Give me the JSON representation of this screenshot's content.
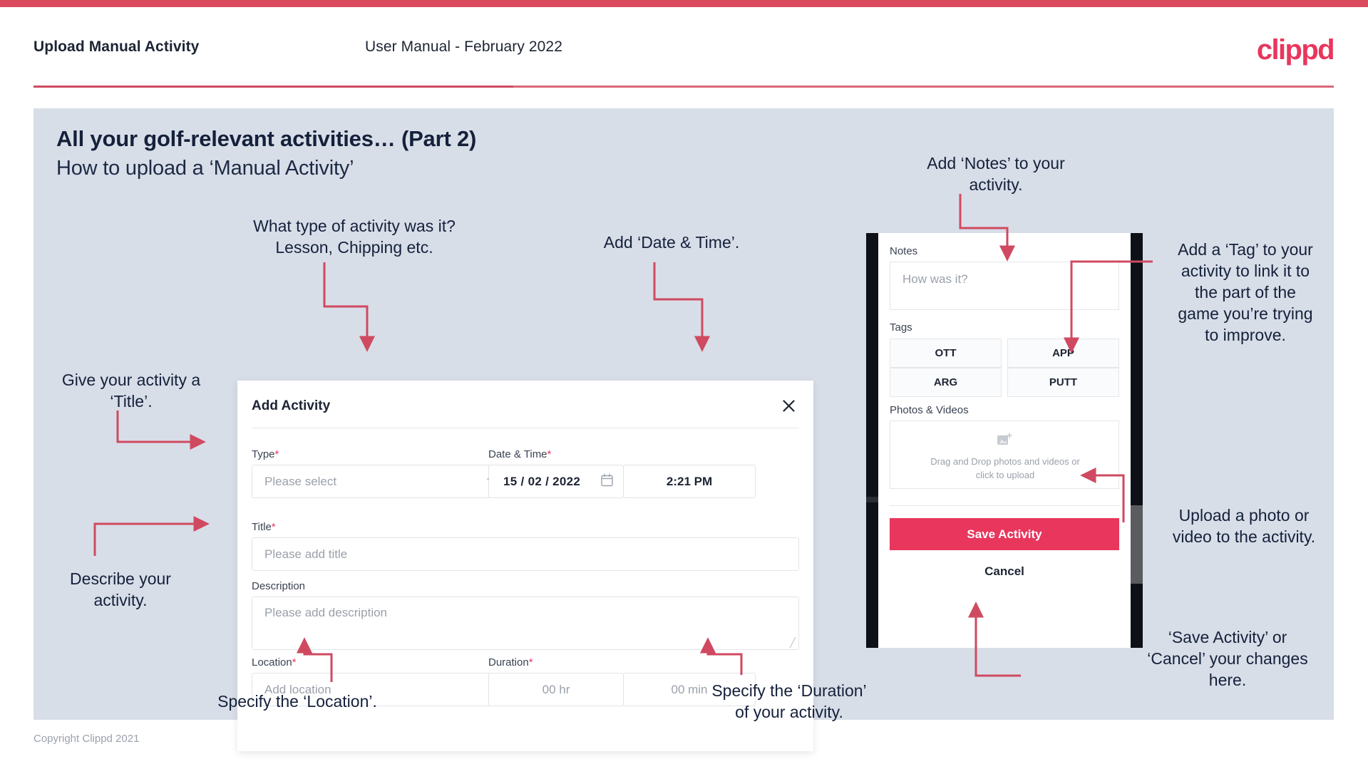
{
  "header": {
    "title": "Upload Manual Activity",
    "subtitle": "User Manual - February 2022",
    "logo": "clippd"
  },
  "slide": {
    "title": "All your golf-relevant activities… (Part 2)",
    "subtitle": "How to upload a ‘Manual Activity’"
  },
  "footer": {
    "copyright": "Copyright Clippd 2021"
  },
  "dialog": {
    "title": "Add Activity",
    "close_icon": "close-icon",
    "fields": {
      "type": {
        "label": "Type",
        "required": "*",
        "placeholder": "Please select",
        "chevron": "chevron-down-icon"
      },
      "datetime": {
        "label": "Date & Time",
        "required": "*",
        "date": "15 /  02  / 2022",
        "time": "2:21 PM",
        "calendar_icon": "calendar-icon"
      },
      "title": {
        "label": "Title",
        "required": "*",
        "placeholder": "Please add title"
      },
      "description": {
        "label": "Description",
        "required": "",
        "placeholder": "Please add description"
      },
      "location": {
        "label": "Location",
        "required": "*",
        "placeholder": "Add location"
      },
      "duration": {
        "label": "Duration",
        "required": "*",
        "hours": "00 hr",
        "minutes": "00 min"
      }
    }
  },
  "phone": {
    "notes": {
      "label": "Notes",
      "placeholder": "How was it?"
    },
    "tags": {
      "label": "Tags",
      "items": [
        "OTT",
        "APP",
        "ARG",
        "PUTT"
      ]
    },
    "photos": {
      "label": "Photos & Videos",
      "icon": "add-image-icon",
      "dropzone_line1": "Drag and Drop photos and videos or",
      "dropzone_line2": "click to upload"
    },
    "save_label": "Save Activity",
    "cancel_label": "Cancel"
  },
  "annotations": {
    "type": "What type of activity was it?\nLesson, Chipping etc.",
    "datetime": "Add ‘Date & Time’.",
    "title": "Give your activity a\n‘Title’.",
    "description": "Describe your\nactivity.",
    "location": "Specify the ‘Location’.",
    "duration": "Specify the ‘Duration’\nof your activity.",
    "notes": "Add ‘Notes’ to your\nactivity.",
    "tags": "Add a ‘Tag’ to your\nactivity to link it to\nthe part of the\ngame you’re trying\nto improve.",
    "photos": "Upload a photo or\nvideo to the activity.",
    "save": "‘Save Activity’ or\n‘Cancel’ your changes\nhere."
  },
  "colors": {
    "brand": "#e8365d",
    "arrow": "#cf4a60",
    "slide_bg": "#d8dee8",
    "ink": "#15213b"
  }
}
